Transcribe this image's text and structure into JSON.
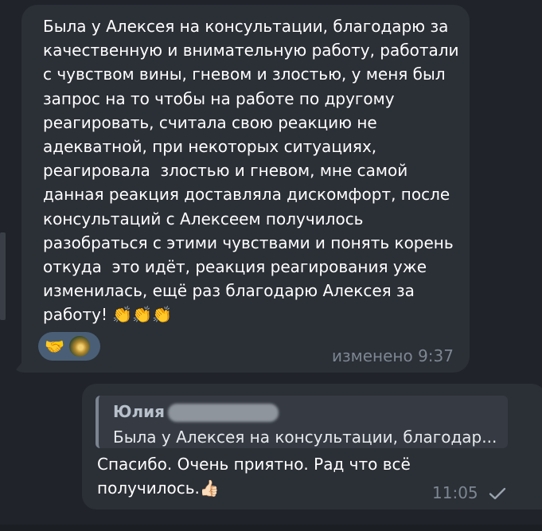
{
  "incoming": {
    "text": "Была у Алексея на консультации, благодарю за качественную и внимательную работу, работали с чувством вины, гневом и злостью, у меня был запрос на то чтобы на работе по другому реагировать, считала свою реакцию не адекватной, при некоторых ситуациях, реагировала  злостью и гневом, мне самой данная реакция доставляла дискомфорт, после консультаций с Алексеем получилось разобраться с этими чувствами и понять корень откуда  это идёт, реакция реагирования уже изменилась, ещё раз благодарю Алексея за работу!",
    "emojis": "👏👏👏",
    "reaction_emoji": "🤝",
    "time": "изменено 9:37"
  },
  "outgoing": {
    "reply_name": "Юлия",
    "reply_snippet": "Была у Алексея на консультации, благодар...",
    "text": "Спасибо. Очень приятно. Рад что всё получилось.",
    "emoji": "👍🏻",
    "time": "11:05"
  },
  "icons": {
    "read_status": "check-icon",
    "reaction_avatar": "avatar"
  }
}
